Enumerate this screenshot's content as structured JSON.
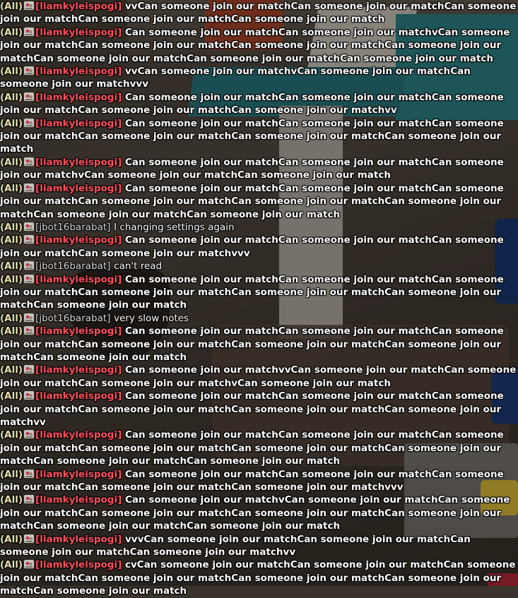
{
  "chat": {
    "messages": [
      {
        "channel": "(All)",
        "user": "[liamkyleispogi]",
        "user_color": "#ff4f5c",
        "text": "vvCan someone join our matchCan someone join our matchCan someone join our matchCan someone join our matchCan someone join our match"
      },
      {
        "channel": "(All)",
        "user": "[liamkyleispogi]",
        "user_color": "#ff4f5c",
        "text": "Can someone join our matchCan someone join our matchvCan someone join our matchCan someone join our matchCan someone join our matchCan someone join our matchCan someone join our matchCan someone join our matchCan someone join our match"
      },
      {
        "channel": "(All)",
        "user": "[liamkyleispogi]",
        "user_color": "#ff4f5c",
        "text": "vvCan someone join our matchvCan someone join our matchCan someone join our matchvvv"
      },
      {
        "channel": "(All)",
        "user": "[liamkyleispogi]",
        "user_color": "#ff4f5c",
        "text": "Can someone join our matchCan someone join our matchCan someone join our matchCan someone join our matchCan someone join our matchvv"
      },
      {
        "channel": "(All)",
        "user": "[liamkyleispogi]",
        "user_color": "#ff4f5c",
        "text": "Can someone join our matchCan someone join our matchCan someone join our matchCan someone join our matchCan someone join our matchCan someone join our match"
      },
      {
        "channel": "(All)",
        "user": "[liamkyleispogi]",
        "user_color": "#ff4f5c",
        "text": "Can someone join our matchCan someone join our matchCan someone join our matchvCan someone join our matchCan someone join our match"
      },
      {
        "channel": "(All)",
        "user": "[liamkyleispogi]",
        "user_color": "#ff4f5c",
        "text": "Can someone join our matchCan someone join our matchCan someone join our matchCan someone join our matchCan someone join our matchCan someone join our matchCan someone join our matchCan someone join our match"
      },
      {
        "channel": "(All)",
        "user": "[jbot16barabat]",
        "user_color": "#d8d8d8",
        "text": "I changing settings again"
      },
      {
        "channel": "(All)",
        "user": "[liamkyleispogi]",
        "user_color": "#ff4f5c",
        "text": "Can someone join our matchCan someone join our matchCan someone join our matchCan someone join our matchvvv"
      },
      {
        "channel": "(All)",
        "user": "[jbot16barabat]",
        "user_color": "#d8d8d8",
        "text": "can't read"
      },
      {
        "channel": "(All)",
        "user": "[liamkyleispogi]",
        "user_color": "#ff4f5c",
        "text": "Can someone join our matchCan someone join our matchCan someone join our matchCan someone join our matchCan someone join our matchCan someone join our matchCan someone join our match"
      },
      {
        "channel": "(All)",
        "user": "[jbot16barabat]",
        "user_color": "#d8d8d8",
        "text": "very slow notes"
      },
      {
        "channel": "(All)",
        "user": "[liamkyleispogi]",
        "user_color": "#ff4f5c",
        "text": "Can someone join our matchCan someone join our matchCan someone join our matchCan someone join our matchCan someone join our matchCan someone join our matchCan someone join our match"
      },
      {
        "channel": "(All)",
        "user": "[liamkyleispogi]",
        "user_color": "#ff4f5c",
        "text": "Can someone join our matchvvCan someone join our matchCan someone join our matchCan someone join our matchvCan someone join our match"
      },
      {
        "channel": "(All)",
        "user": "[liamkyleispogi]",
        "user_color": "#ff4f5c",
        "text": "Can someone join our matchCan someone join our matchCan someone join our matchCan someone join our matchCan someone join our matchCan someone join our matchvv"
      },
      {
        "channel": "(All)",
        "user": "[liamkyleispogi]",
        "user_color": "#ff4f5c",
        "text": "Can someone join our matchCan someone join our matchCan someone join our matchCan someone join our matchCan someone join our matchCan someone join our matchCan someone join our matchCan someone join our match"
      },
      {
        "channel": "(All)",
        "user": "[liamkyleispogi]",
        "user_color": "#ff4f5c",
        "text": "Can someone join our matchCan someone join our matchCan someone join our matchCan someone join our matchCan someone join our matchvvv"
      },
      {
        "channel": "(All)",
        "user": "[liamkyleispogi]",
        "user_color": "#ff4f5c",
        "text": "Can someone join our matchvCan someone join our matchCan someone join our matchCan someone join our matchCan someone join our matchCan someone join our matchCan someone join our matchCan someone join our match"
      },
      {
        "channel": "(All)",
        "user": "[liamkyleispogi]",
        "user_color": "#ff4f5c",
        "text": "vvvCan someone join our matchCan someone join our matchCan someone join our matchCan someone join our matchvv"
      },
      {
        "channel": "(All)",
        "user": "[liamkyleispogi]",
        "user_color": "#ff4f5c",
        "text": "cvCan someone join our matchCan someone join our matchCan someone join our matchCan someone join our matchCan someone join our matchCan someone join our matchCan someone join our match"
      }
    ]
  }
}
